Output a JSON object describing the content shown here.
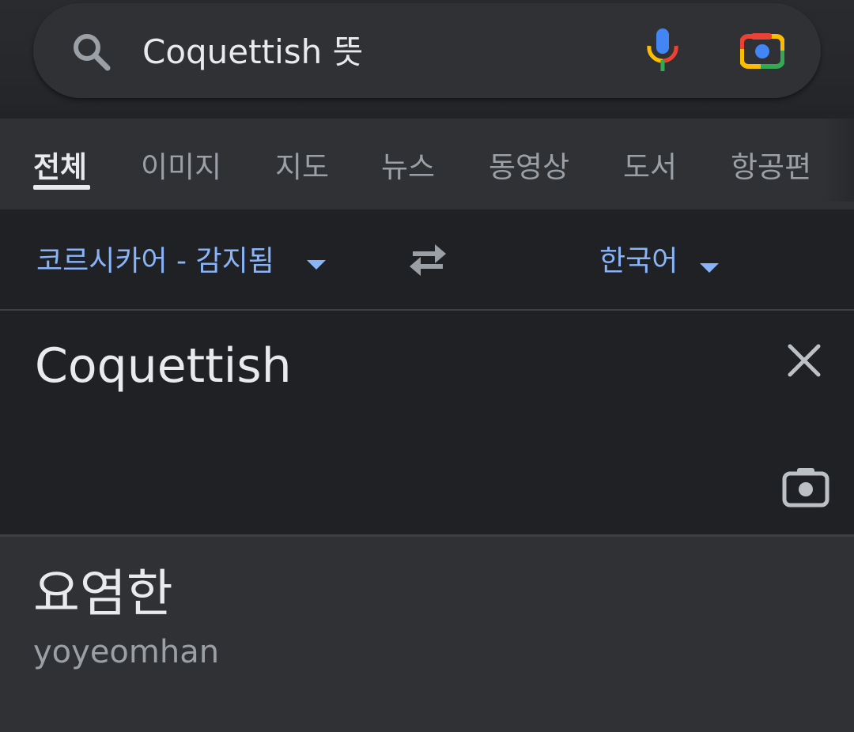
{
  "search": {
    "query": "Coquettish 뜻",
    "icons": [
      "search-icon",
      "mic-icon",
      "google-lens-icon"
    ]
  },
  "tabs": [
    {
      "label": "전체",
      "active": true
    },
    {
      "label": "이미지"
    },
    {
      "label": "지도"
    },
    {
      "label": "뉴스"
    },
    {
      "label": "동영상"
    },
    {
      "label": "도서"
    },
    {
      "label": "항공편"
    }
  ],
  "translator": {
    "source_language": "코르시카어 - 감지됨",
    "target_language": "한국어",
    "source_text": "Coquettish",
    "translation": "요염한",
    "romanization": "yoyeomhan"
  },
  "colors": {
    "background": "#202124",
    "surface": "#303134",
    "accent_blue": "#8ab4f8",
    "text_primary": "#e8eaed",
    "text_secondary": "#9aa0a6"
  }
}
